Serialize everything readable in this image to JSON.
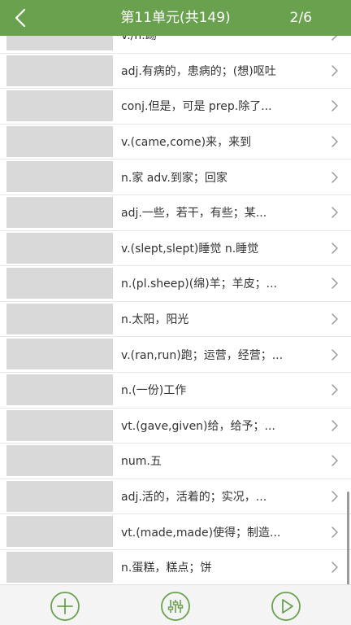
{
  "header": {
    "back_icon": "chevron-left-icon",
    "title": "第11单元(共149)",
    "page_indicator": "2/6"
  },
  "colors": {
    "header_bg": "#6aa14f",
    "accent": "#6aa14f",
    "thumb_placeholder": "#d9d9d9"
  },
  "list": {
    "items": [
      {
        "definition": "v./n.踢"
      },
      {
        "definition": "adj.有病的，患病的；(想)呕吐"
      },
      {
        "definition": "conj.但是，可是 prep.除了..."
      },
      {
        "definition": "v.(came,come)来，来到"
      },
      {
        "definition": "n.家 adv.到家；回家"
      },
      {
        "definition": "adj.一些，若干，有些；某..."
      },
      {
        "definition": "v.(slept,slept)睡觉 n.睡觉"
      },
      {
        "definition": "n.(pl.sheep)(绵)羊；羊皮；..."
      },
      {
        "definition": "n.太阳，阳光"
      },
      {
        "definition": "v.(ran,run)跑；运营，经营；..."
      },
      {
        "definition": "n.(一份)工作"
      },
      {
        "definition": "vt.(gave,given)给，给予；..."
      },
      {
        "definition": "num.五"
      },
      {
        "definition": "adj.活的，活着的；实况，..."
      },
      {
        "definition": "vt.(made,made)使得；制造..."
      },
      {
        "definition": "n.蛋糕，糕点；饼"
      }
    ]
  },
  "toolbar": {
    "add_icon": "plus-circle-icon",
    "settings_icon": "sliders-icon",
    "play_icon": "play-circle-icon"
  }
}
